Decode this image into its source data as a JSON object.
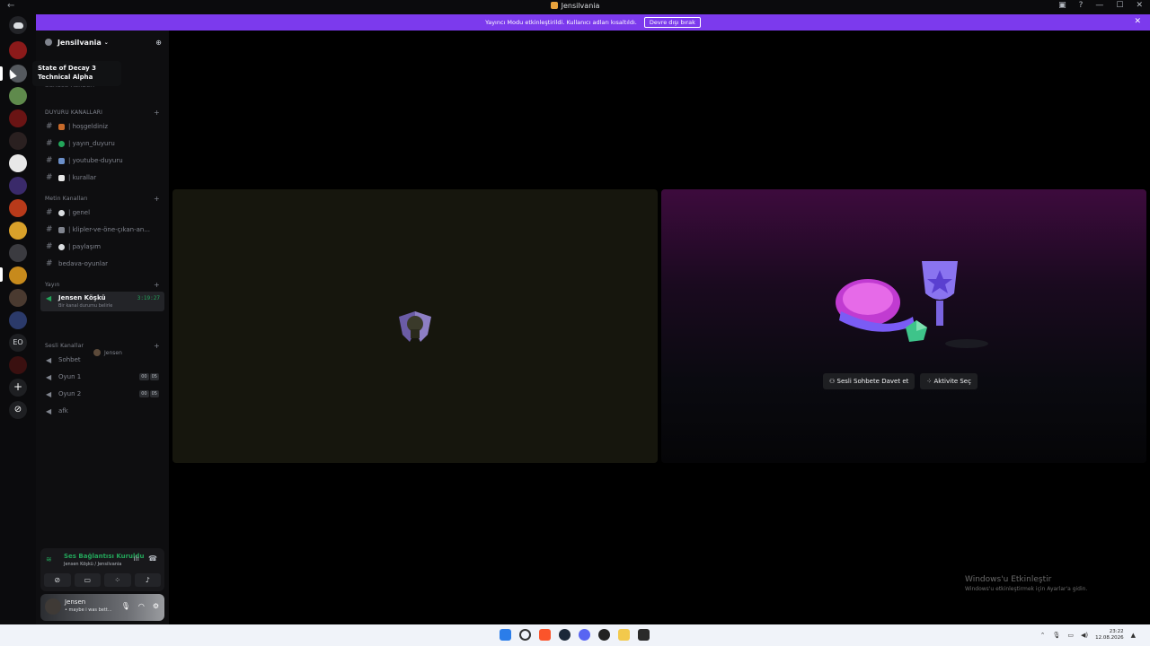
{
  "window": {
    "title": "Jensilvania",
    "controls": [
      "—",
      "☐",
      "✕"
    ]
  },
  "banner": {
    "text": "Yayıncı Modu etkinleştirildi. Kullanıcı adları kısaltıldı.",
    "button_label": "Devre dışı bırak"
  },
  "tooltip": {
    "line1": "State of Decay 3",
    "line2": "Technical Alpha"
  },
  "rail": {
    "eo_label": "EO"
  },
  "guild": {
    "name": "Jensilvania",
    "hidden_row": "Sunucu Rehberi"
  },
  "categories": {
    "duyuru": "DUYURU KANALLARI",
    "metin": "Metin Kanalları",
    "yayin": "Yayın",
    "sesli": "Sesli Kanallar"
  },
  "channels": {
    "hosgeldiniz": "| hoşgeldiniz",
    "yayin_duyuru": "| yayın_duyuru",
    "youtube_duyuru": "| youtube-duyuru",
    "kurallar": "| kurallar",
    "genel": "| genel",
    "klipler": "| klipler-ve-öne-çıkan-an...",
    "paylasim": "| paylaşım",
    "bedava": "bedava-oyunlar"
  },
  "stage": {
    "name": "Jensen Köşkü",
    "timer": "3:19:27",
    "status": "Bir kanal durumu belirle",
    "member": "Jensen"
  },
  "voice_channels": {
    "sohbet": "Sohbet",
    "oyun1": "Oyun 1",
    "oyun1_counts": [
      "00",
      "05"
    ],
    "oyun2": "Oyun 2",
    "oyun2_counts": [
      "00",
      "05"
    ],
    "afk": "afk"
  },
  "voice_panel": {
    "status": "Ses Bağlantısı Kuruldu",
    "location": "Jensen Köşkü / Jensilvania"
  },
  "user": {
    "name": "Jensen",
    "status": "• maybe i was bett..."
  },
  "tile_actions": {
    "invite": "Sesli Sohbete Davet et",
    "activity": "Aktivite Seç"
  },
  "watermark": {
    "line1": "Windows'u Etkinleştir",
    "line2": "Windows'u etkinleştirmek için Ayarlar'a gidin."
  },
  "taskbar": {
    "time": "23:22",
    "date": "12.08.2026"
  },
  "colors": {
    "banner": "#7c3aed",
    "accent_green": "#23a55a",
    "sidebar_bg": "#0e0e10"
  }
}
